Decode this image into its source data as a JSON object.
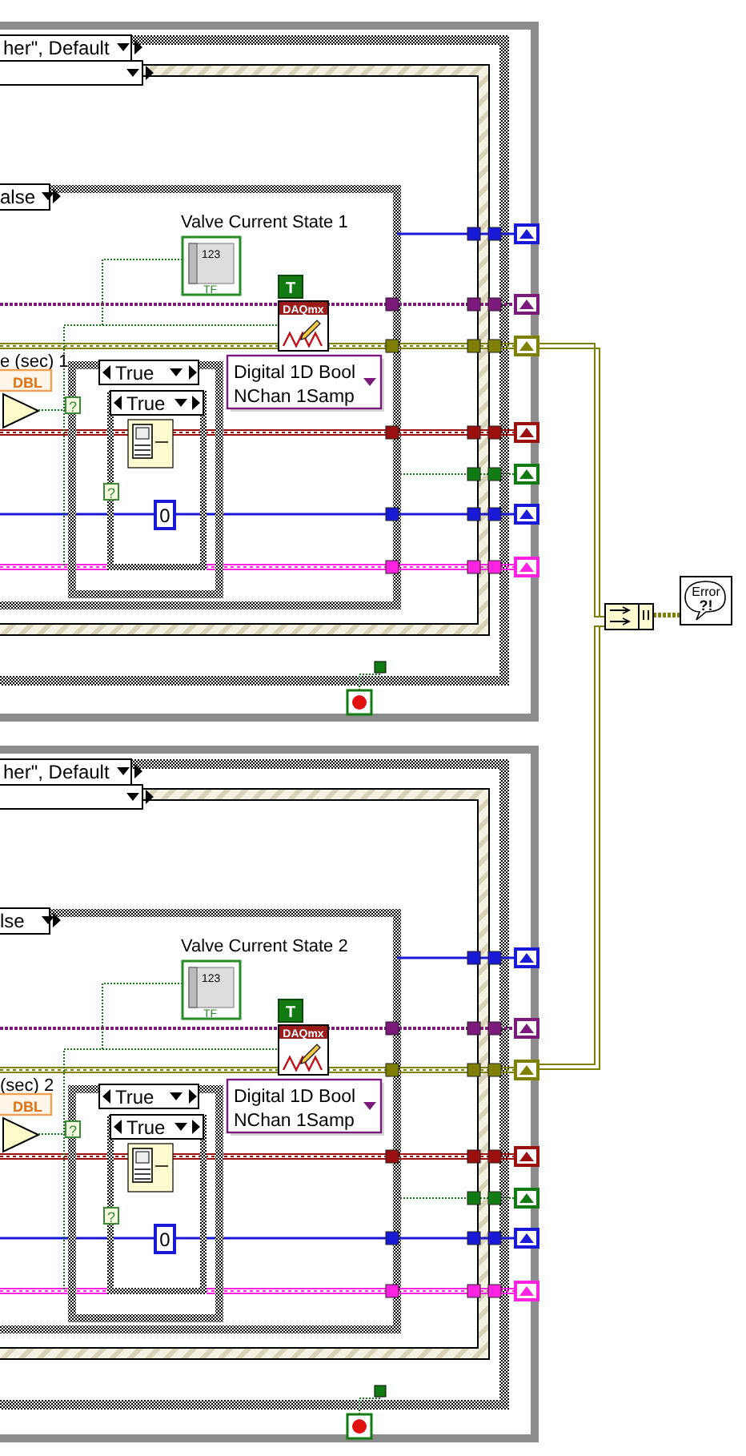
{
  "panels": [
    {
      "outer_case_label": "her\", Default",
      "inner_case_label": "alse",
      "timing_label": "e (sec) 1",
      "type_tag": "DBL",
      "indicator_label": "Valve Current State 1",
      "indicator_glyph": "123",
      "indicator_type": "TF",
      "constant_true": "T",
      "daqmx_label": "DAQmx",
      "daqmx_mode_lines": [
        "Digital 1D Bool",
        "NChan 1Samp"
      ],
      "outer_true_label": "True",
      "inner_true_label": "True",
      "selector_terminal": "?",
      "numeric_constant": "0",
      "wires": [
        {
          "color": "#1a1ad6"
        },
        {
          "color": "#7b1a7b"
        },
        {
          "color": "#7f7f00"
        },
        {
          "color": "#9b0f0f"
        },
        {
          "color": "#127a12"
        },
        {
          "color": "#1a1ad6"
        },
        {
          "color": "#ff22e0"
        }
      ]
    },
    {
      "outer_case_label": "her\", Default",
      "inner_case_label": "lse",
      "timing_label": "(sec) 2",
      "type_tag": "DBL",
      "indicator_label": "Valve Current State 2",
      "indicator_glyph": "123",
      "indicator_type": "TF",
      "constant_true": "T",
      "daqmx_label": "DAQmx",
      "daqmx_mode_lines": [
        "Digital 1D Bool",
        "NChan 1Samp"
      ],
      "outer_true_label": "True",
      "inner_true_label": "True",
      "selector_terminal": "?",
      "numeric_constant": "0",
      "wires": [
        {
          "color": "#1a1ad6"
        },
        {
          "color": "#7b1a7b"
        },
        {
          "color": "#7f7f00"
        },
        {
          "color": "#9b0f0f"
        },
        {
          "color": "#127a12"
        },
        {
          "color": "#1a1ad6"
        },
        {
          "color": "#ff22e0"
        }
      ]
    }
  ],
  "error_indicator": {
    "title": "Error",
    "mark": "?!"
  }
}
